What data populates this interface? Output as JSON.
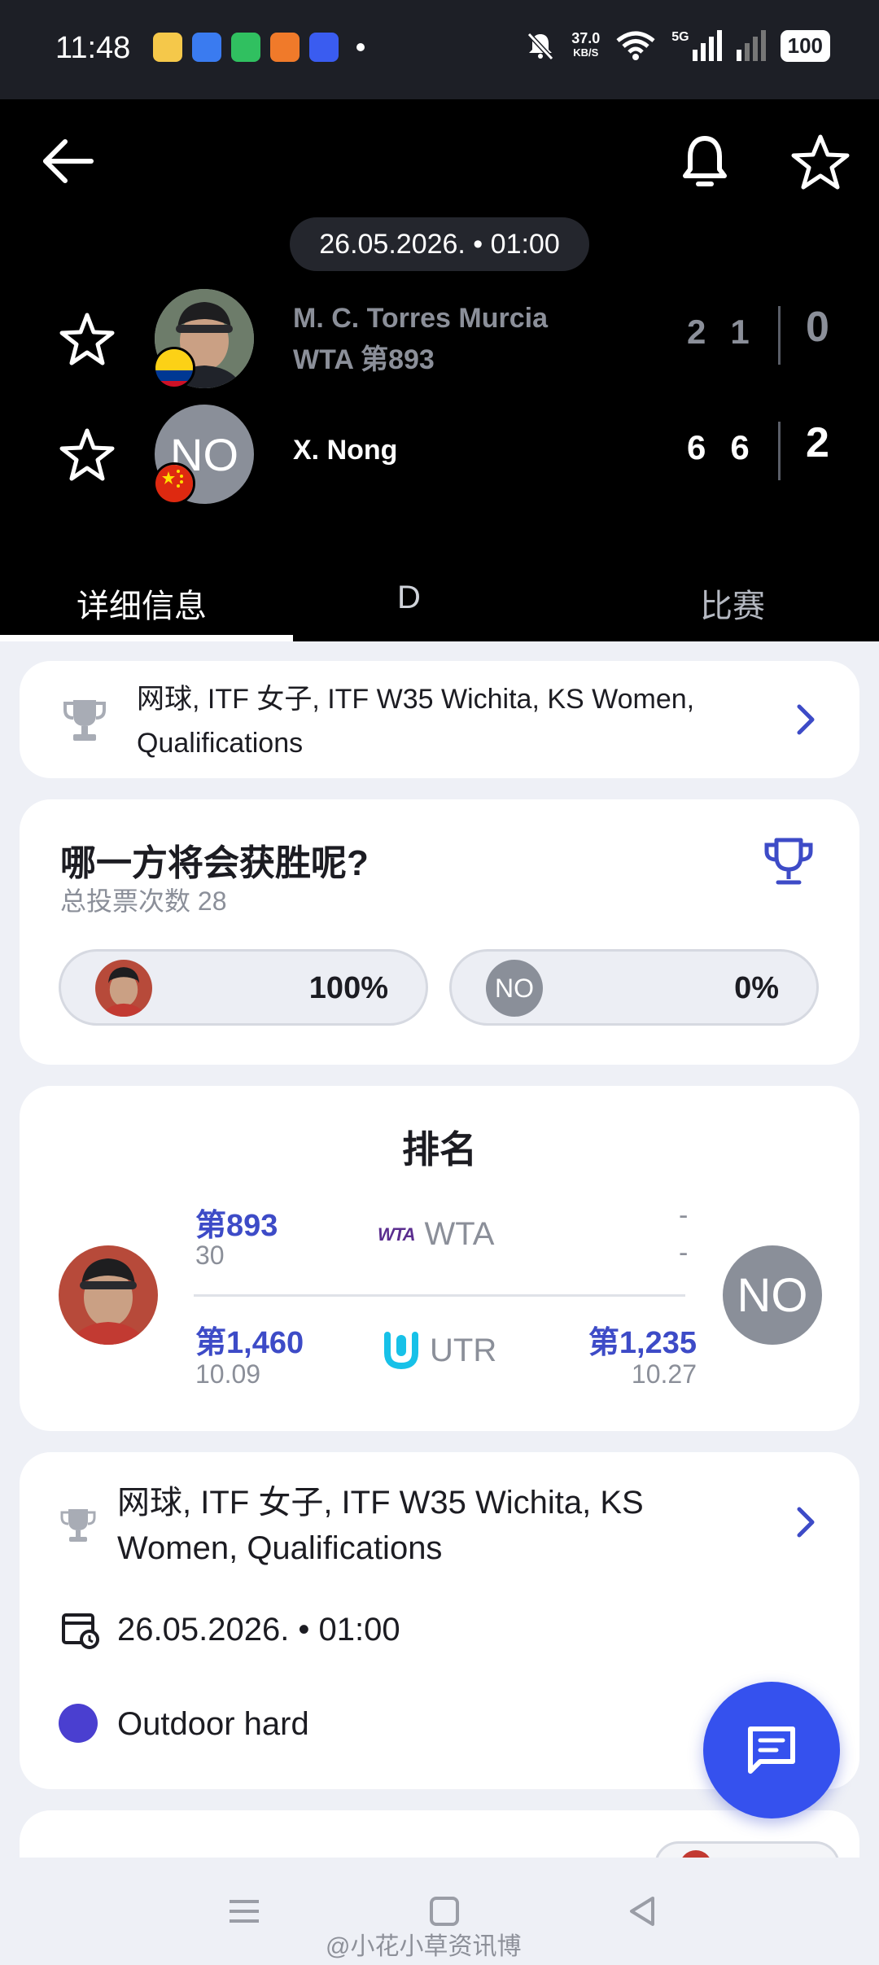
{
  "status_bar": {
    "time": "11:48",
    "net_speed_value": "37.0",
    "net_speed_unit": "KB/S",
    "network": "5G",
    "battery": "100"
  },
  "match": {
    "datetime": "26.05.2026. • 01:00",
    "player1": {
      "name": "M. C. Torres Murcia",
      "rank": "WTA 第893",
      "sets": [
        "2",
        "1"
      ],
      "games": "0",
      "flag": "Colombia"
    },
    "player2": {
      "name": "X. Nong",
      "initials": "NO",
      "sets": [
        "6",
        "6"
      ],
      "games": "2",
      "flag": "China"
    }
  },
  "tabs": [
    {
      "label": "详细信息"
    },
    {
      "label": "D"
    },
    {
      "label": "比赛"
    }
  ],
  "tournament": {
    "label": "网球, ITF 女子, ITF W35 Wichita, KS Women, Qualifications"
  },
  "vote": {
    "title": "哪一方将会获胜呢?",
    "total_votes": "总投票次数 28",
    "player1_pct": "100%",
    "player2_initials": "NO",
    "player2_pct": "0%"
  },
  "ranking": {
    "title": "排名",
    "wta": {
      "label": "WTA",
      "p1_rank": "第893",
      "p1_sub": "30",
      "p2_rank": "-",
      "p2_sub": "-"
    },
    "utr": {
      "label": "UTR",
      "p1_rank": "第1,460",
      "p1_sub": "10.09",
      "p2_rank": "第1,235",
      "p2_sub": "10.27"
    },
    "p2_initials": "NO"
  },
  "info": {
    "tournament": "网球, ITF 女子, ITF W35 Wichita, KS Women, Qualifications",
    "datetime": "26.05.2026. • 01:00",
    "surface": "Outdoor hard"
  },
  "watermark": "@小花小草资讯博",
  "colors": {
    "accent": "#3551ee",
    "rank_blue": "#3d4bc7",
    "surface": "#4a3fd0",
    "header_bg": "#000000"
  }
}
